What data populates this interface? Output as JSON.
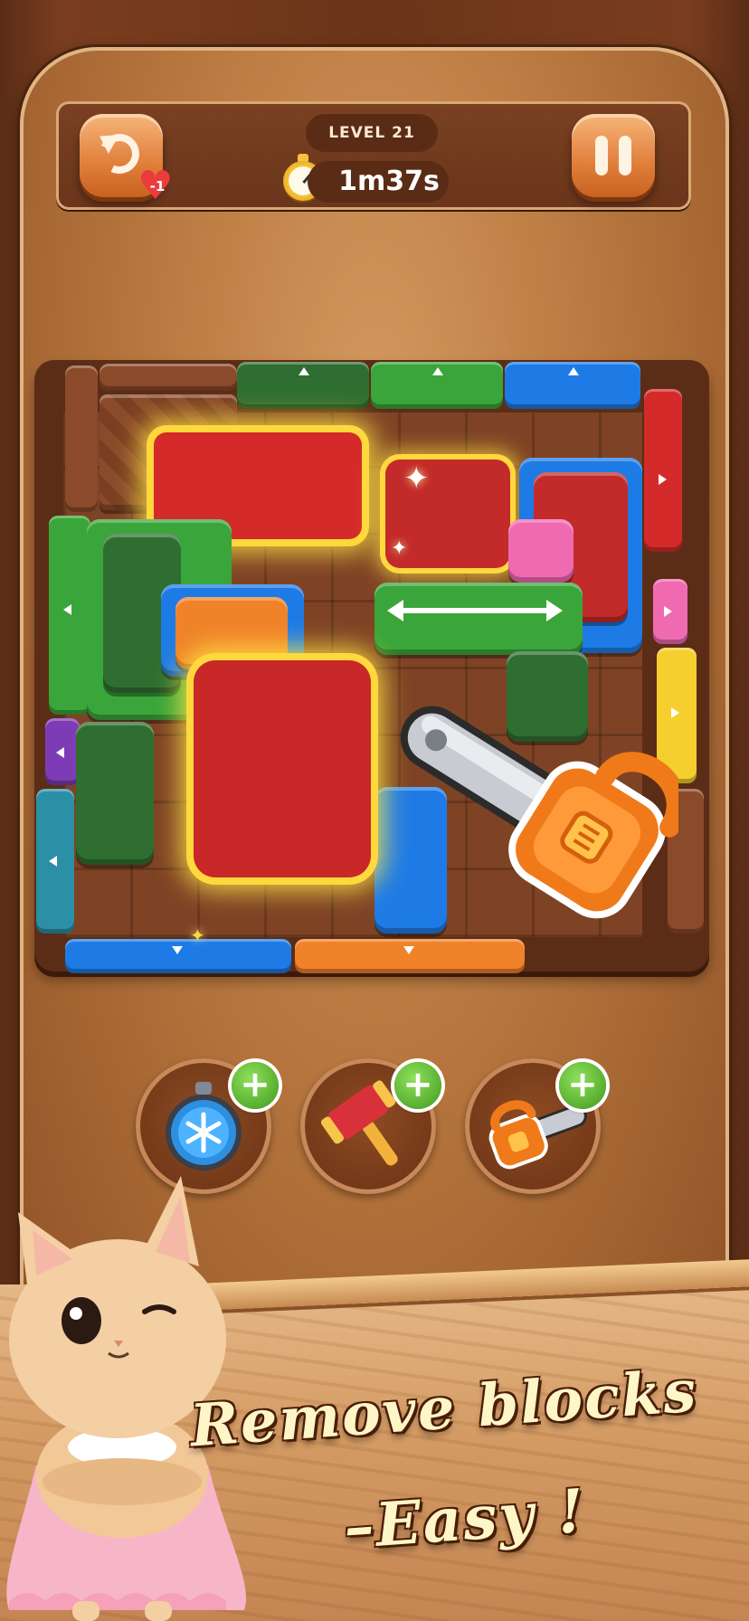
{
  "hud": {
    "level_label": "LEVEL 21",
    "timer": "1m37s",
    "undo_cost": "-1"
  },
  "boosters": [
    {
      "name": "freeze-time",
      "icon": "snowflake-stopwatch-icon"
    },
    {
      "name": "hammer",
      "icon": "hammer-icon"
    },
    {
      "name": "chainsaw",
      "icon": "chainsaw-icon"
    }
  ],
  "slogan": {
    "line1": "Remove  blocks",
    "line2": "–Easy !"
  },
  "colors": {
    "red": "#d42a2a",
    "green": "#3aa53a",
    "dark_green": "#2f6e31",
    "blue": "#1e7be6",
    "orange": "#f0822a",
    "yellow": "#f5cf2e",
    "pink": "#f06ab2",
    "purple": "#7d3bb5",
    "teal": "#2b8fa5",
    "highlight": "#ffd83d"
  }
}
